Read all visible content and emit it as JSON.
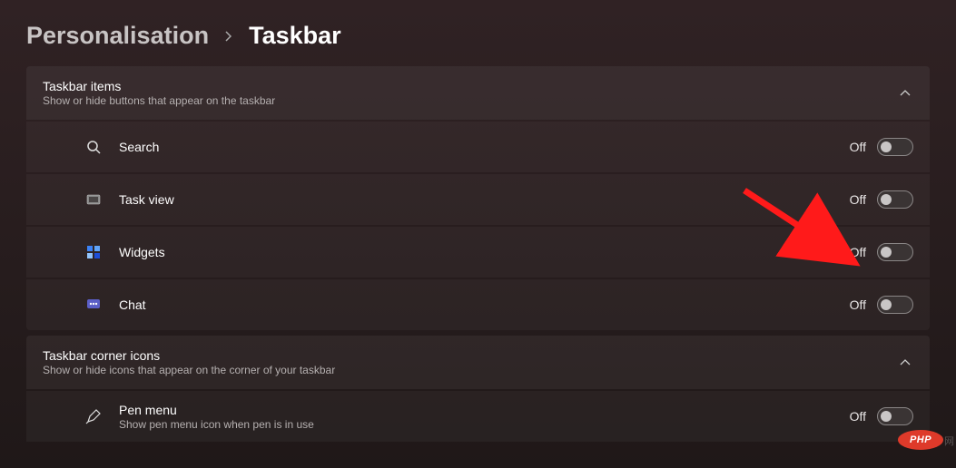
{
  "breadcrumb": {
    "parent": "Personalisation",
    "current": "Taskbar"
  },
  "sections": {
    "taskbar_items": {
      "title": "Taskbar items",
      "subtitle": "Show or hide buttons that appear on the taskbar",
      "rows": {
        "search": {
          "label": "Search",
          "state": "Off"
        },
        "taskview": {
          "label": "Task view",
          "state": "Off"
        },
        "widgets": {
          "label": "Widgets",
          "state": "Off"
        },
        "chat": {
          "label": "Chat",
          "state": "Off"
        }
      }
    },
    "corner_icons": {
      "title": "Taskbar corner icons",
      "subtitle": "Show or hide icons that appear on the corner of your taskbar",
      "rows": {
        "pen": {
          "label": "Pen menu",
          "sub": "Show pen menu icon when pen is in use",
          "state": "Off"
        }
      }
    }
  },
  "watermark": {
    "php": "PHP",
    "cn": "网"
  }
}
